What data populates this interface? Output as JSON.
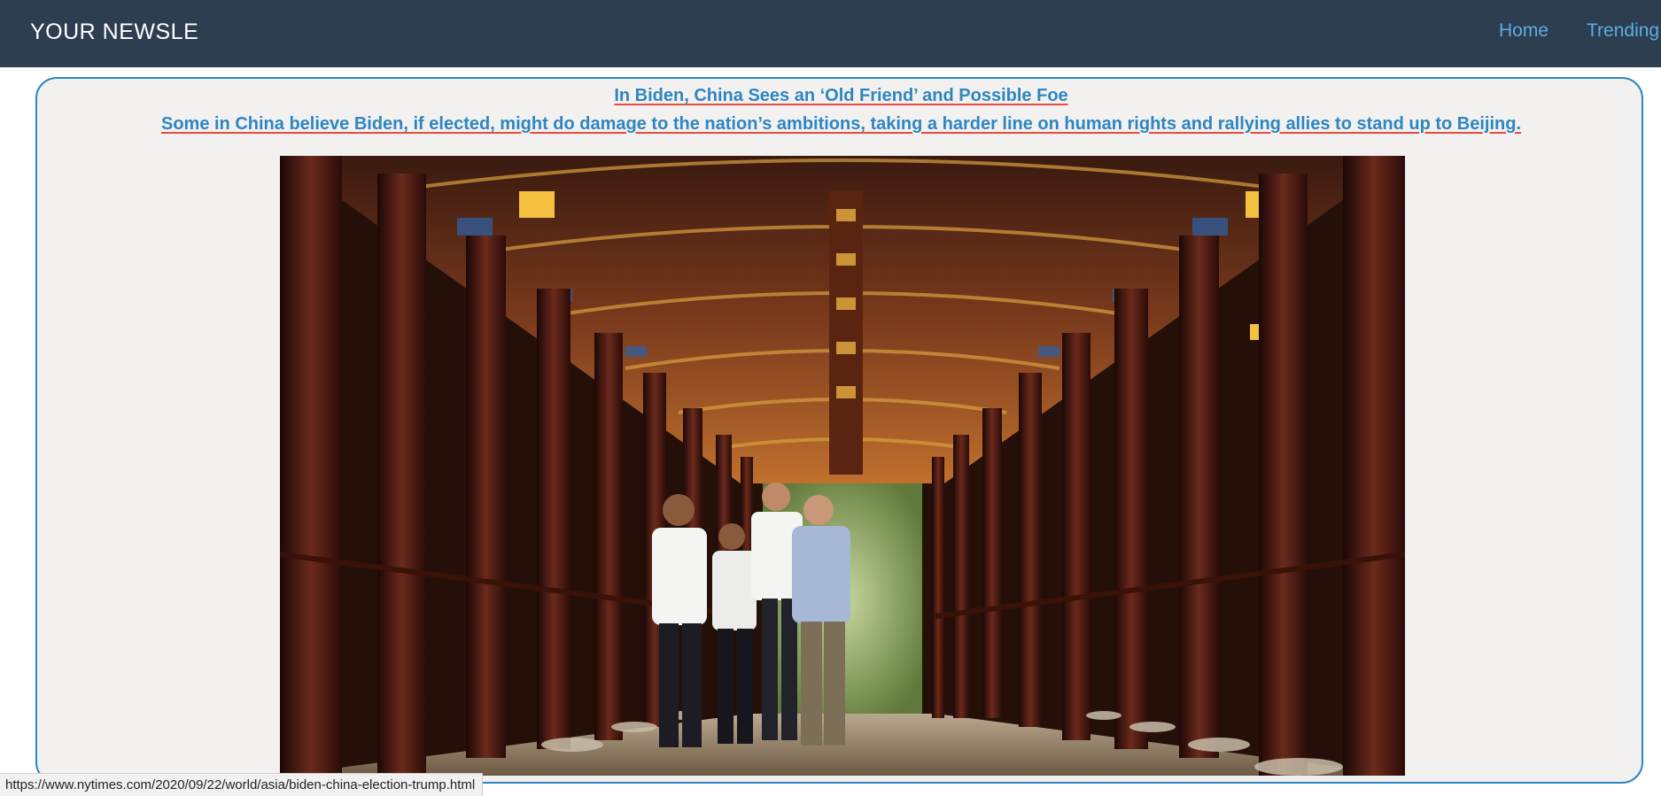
{
  "navbar": {
    "brand": "YOUR NEWSLE",
    "links": [
      {
        "label": "Home"
      },
      {
        "label": "Trending"
      }
    ]
  },
  "article": {
    "title": "In Biden, China Sees an ‘Old Friend’ and Possible Foe",
    "summary": "Some in China believe Biden, if elected, might do damage to the nation’s ambitions, taking a harder line on human rights and rallying allies to stand up to Beijing.",
    "image_description": "Men walking through an ornate Chinese covered corridor"
  },
  "status_bar": {
    "url": "https://www.nytimes.com/2020/09/22/world/asia/biden-china-election-trump.html"
  },
  "colors": {
    "navbar_bg": "#2c3e50",
    "link": "#5dade2",
    "headline": "#2e86c1",
    "underline": "#e74c3c",
    "card_bg": "#f2f1f0"
  }
}
